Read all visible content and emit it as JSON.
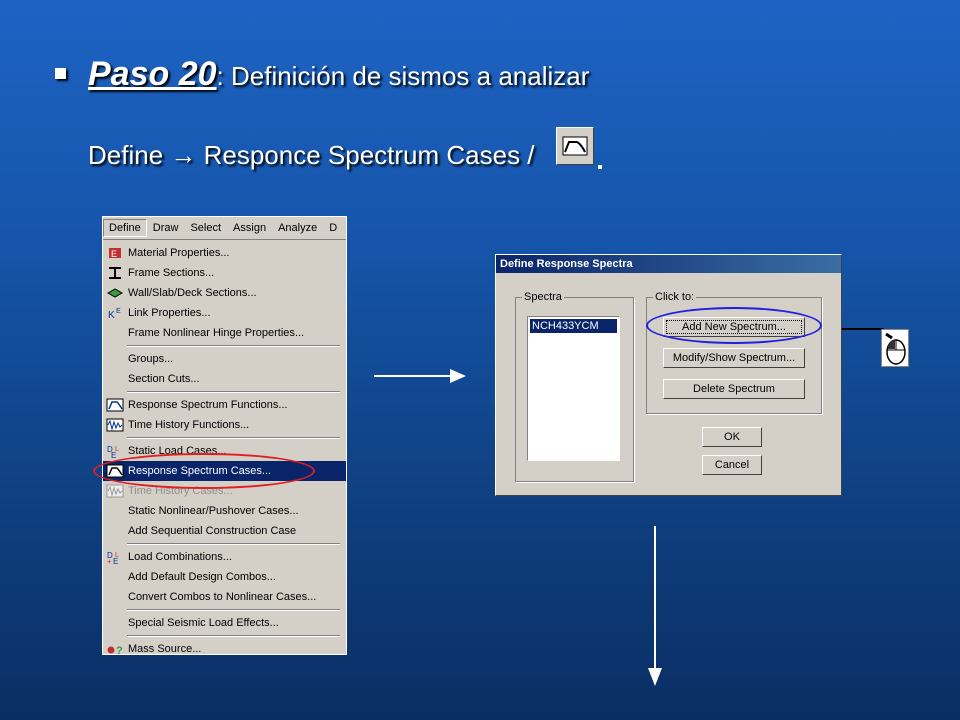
{
  "slide": {
    "bullet_bold": "Paso 20",
    "bullet_rest": ": Definición de sismos a analizar",
    "subtitle": "Define → Responce Spectrum Cases /"
  },
  "menu": {
    "bar": [
      "Define",
      "Draw",
      "Select",
      "Assign",
      "Analyze",
      "D"
    ],
    "items": [
      {
        "label": "Material Properties...",
        "icon": "material-icon"
      },
      {
        "label": "Frame Sections...",
        "icon": "frame-section-icon"
      },
      {
        "label": "Wall/Slab/Deck Sections...",
        "icon": "wall-slab-icon"
      },
      {
        "label": "Link Properties...",
        "icon": "link-icon"
      },
      {
        "label": "Frame Nonlinear Hinge Properties...",
        "icon": ""
      },
      {
        "label": "Groups...",
        "icon": ""
      },
      {
        "label": "Section Cuts...",
        "icon": ""
      },
      {
        "label": "Response Spectrum Functions...",
        "icon": "spectrum-function-icon"
      },
      {
        "label": "Time History Functions...",
        "icon": "time-history-icon"
      },
      {
        "label": "Static Load Cases...",
        "icon": "static-load-icon"
      },
      {
        "label": "Response Spectrum Cases...",
        "icon": "spectrum-case-icon"
      },
      {
        "label": "Time History Cases...",
        "icon": "time-history-case-icon"
      },
      {
        "label": "Static Nonlinear/Pushover Cases...",
        "icon": ""
      },
      {
        "label": "Add Sequential Construction Case",
        "icon": ""
      },
      {
        "label": "Load Combinations...",
        "icon": "load-combo-icon"
      },
      {
        "label": "Add Default Design Combos...",
        "icon": ""
      },
      {
        "label": "Convert Combos to Nonlinear Cases...",
        "icon": ""
      },
      {
        "label": "Special Seismic Load Effects...",
        "icon": ""
      },
      {
        "label": "Mass Source...",
        "icon": "mass-source-icon"
      }
    ]
  },
  "dialog": {
    "title": "Define Response Spectra",
    "spectra_label": "Spectra",
    "spectra_items": [
      "NCH433YCM"
    ],
    "click_to_label": "Click to:",
    "add_button": "Add New Spectrum...",
    "modify_button": "Modify/Show Spectrum...",
    "delete_button": "Delete Spectrum",
    "ok_button": "OK",
    "cancel_button": "Cancel"
  },
  "colors": {
    "highlight_ellipse": "#e02020",
    "button_ellipse": "#2020e0",
    "selection": "#0a246a"
  }
}
